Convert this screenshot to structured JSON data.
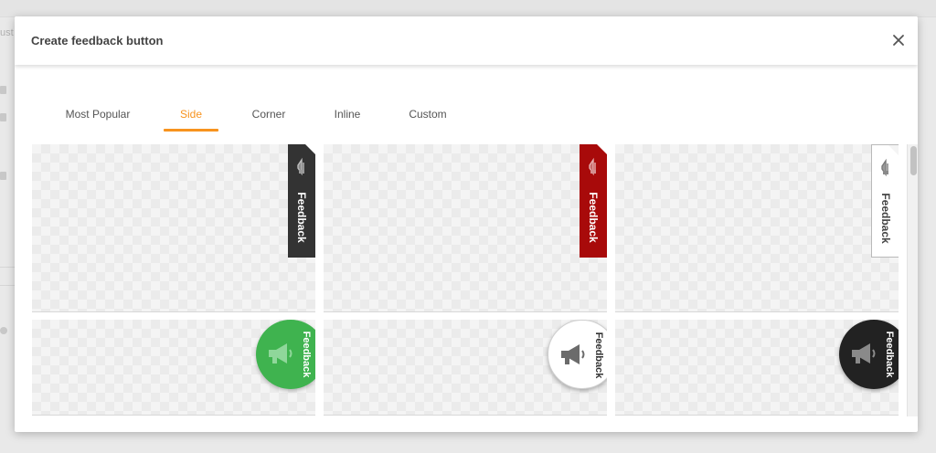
{
  "background": {
    "side_text": "ust"
  },
  "modal": {
    "title": "Create feedback button",
    "close_icon": "close-icon"
  },
  "tabs": [
    {
      "label": "Most Popular",
      "active": false
    },
    {
      "label": "Side",
      "active": true
    },
    {
      "label": "Corner",
      "active": false
    },
    {
      "label": "Inline",
      "active": false
    },
    {
      "label": "Custom",
      "active": false
    }
  ],
  "previews": [
    {
      "style": "side-tab",
      "color": "#333333",
      "label": "Feedback",
      "icon": "megaphone-icon"
    },
    {
      "style": "side-tab",
      "color": "#a80a0a",
      "label": "Feedback",
      "icon": "megaphone-icon"
    },
    {
      "style": "side-tab",
      "color": "#ffffff",
      "label": "Feedback",
      "icon": "megaphone-icon"
    },
    {
      "style": "circle",
      "color": "#3fb34f",
      "label": "Feedback",
      "icon": "megaphone-icon"
    },
    {
      "style": "circle",
      "color": "#ffffff",
      "label": "Feedback",
      "icon": "megaphone-icon"
    },
    {
      "style": "circle",
      "color": "#222222",
      "label": "Feedback",
      "icon": "megaphone-icon"
    }
  ],
  "colors": {
    "accent": "#f7931e",
    "title_text": "#444444",
    "tab_text": "#555555"
  }
}
